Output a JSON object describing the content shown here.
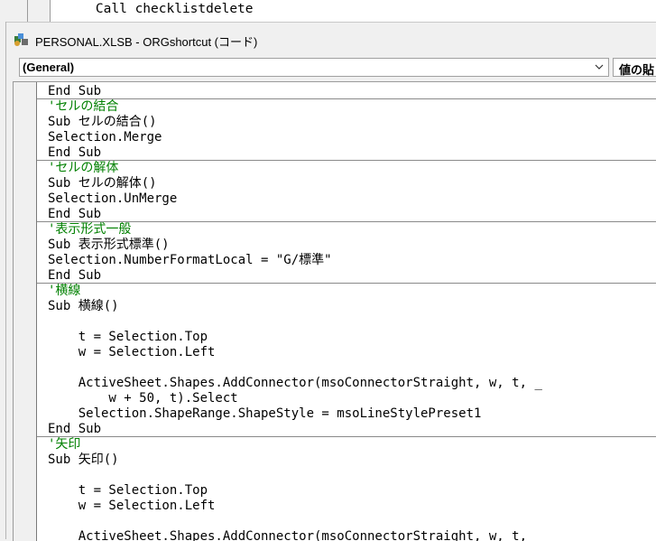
{
  "background_window": {
    "code_line": "    Call checklistdelete"
  },
  "window": {
    "title": "PERSONAL.XLSB - ORGshortcut (コード)",
    "icon": "vba-module-icon"
  },
  "object_combo": {
    "value": "(General)"
  },
  "procedure_combo": {
    "value": "値の貼り付け"
  },
  "code_lines": [
    {
      "text": "End Sub",
      "type": "code",
      "sep": false
    },
    {
      "text": "'セルの結合",
      "type": "comment",
      "sep": true
    },
    {
      "text": "Sub セルの結合()",
      "type": "code",
      "sep": false
    },
    {
      "text": "Selection.Merge",
      "type": "code",
      "sep": false
    },
    {
      "text": "End Sub",
      "type": "code",
      "sep": false
    },
    {
      "text": "'セルの解体",
      "type": "comment",
      "sep": true
    },
    {
      "text": "Sub セルの解体()",
      "type": "code",
      "sep": false
    },
    {
      "text": "Selection.UnMerge",
      "type": "code",
      "sep": false
    },
    {
      "text": "End Sub",
      "type": "code",
      "sep": false
    },
    {
      "text": "'表示形式一般",
      "type": "comment",
      "sep": true
    },
    {
      "text": "Sub 表示形式標準()",
      "type": "code",
      "sep": false
    },
    {
      "text": "Selection.NumberFormatLocal = \"G/標準\"",
      "type": "code",
      "sep": false
    },
    {
      "text": "End Sub",
      "type": "code",
      "sep": false
    },
    {
      "text": "'横線",
      "type": "comment",
      "sep": true
    },
    {
      "text": "Sub 横線()",
      "type": "code",
      "sep": false
    },
    {
      "text": "",
      "type": "code",
      "sep": false
    },
    {
      "text": "    t = Selection.Top",
      "type": "code",
      "sep": false
    },
    {
      "text": "    w = Selection.Left",
      "type": "code",
      "sep": false
    },
    {
      "text": "",
      "type": "code",
      "sep": false
    },
    {
      "text": "    ActiveSheet.Shapes.AddConnector(msoConnectorStraight, w, t, _",
      "type": "code",
      "sep": false
    },
    {
      "text": "        w + 50, t).Select",
      "type": "code",
      "sep": false
    },
    {
      "text": "    Selection.ShapeRange.ShapeStyle = msoLineStylePreset1",
      "type": "code",
      "sep": false
    },
    {
      "text": "End Sub",
      "type": "code",
      "sep": false
    },
    {
      "text": "'矢印",
      "type": "comment",
      "sep": true
    },
    {
      "text": "Sub 矢印()",
      "type": "code",
      "sep": false
    },
    {
      "text": "",
      "type": "code",
      "sep": false
    },
    {
      "text": "    t = Selection.Top",
      "type": "code",
      "sep": false
    },
    {
      "text": "    w = Selection.Left",
      "type": "code",
      "sep": false
    },
    {
      "text": "",
      "type": "code",
      "sep": false
    },
    {
      "text": "    ActiveSheet.Shapes.AddConnector(msoConnectorStraight, w, t,",
      "type": "code",
      "sep": false
    }
  ],
  "colors": {
    "comment": "#008000",
    "code": "#000000",
    "editor_bg": "#ffffff",
    "chrome_bg": "#f0f0f0"
  }
}
